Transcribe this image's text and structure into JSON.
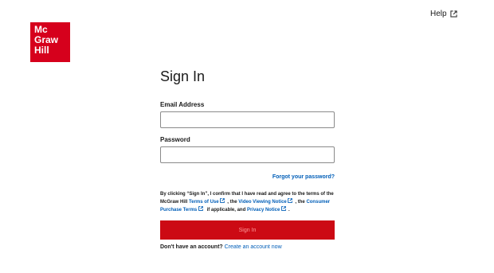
{
  "brand": {
    "line1": "Mc",
    "line2": "Graw",
    "line3": "Hill",
    "color": "#d6001c"
  },
  "header": {
    "help_label": "Help"
  },
  "form": {
    "title": "Sign In",
    "email_label": "Email Address",
    "email_value": "",
    "password_label": "Password",
    "password_value": "",
    "forgot_label": "Forgot your password?",
    "terms": {
      "prefix": "By clicking “Sign In”, I confirm that I have read and agree to the terms of the McGraw Hill ",
      "terms_of_use": "Terms of Use",
      "sep1": ", the ",
      "video_notice": "Video Viewing Notice",
      "sep2": ", the ",
      "consumer_terms": "Consumer Purchase Terms",
      "sep3": " if applicable, and ",
      "privacy": "Privacy Notice",
      "suffix": "."
    },
    "signin_label": "Sign In",
    "signin_color": "#cc0a14",
    "no_account": "Don't have an account?",
    "create_account": "Create an account now"
  }
}
